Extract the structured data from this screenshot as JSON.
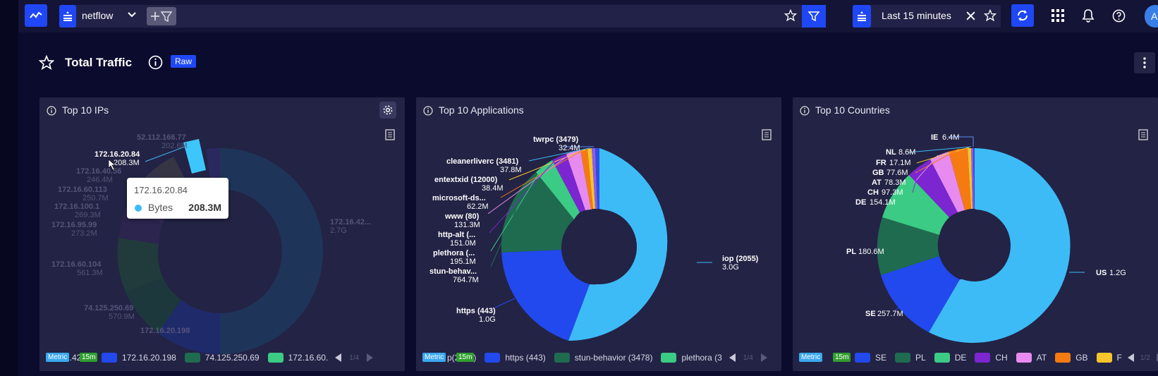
{
  "topbar": {
    "index_name": "netflow",
    "time_range": "Last 15 minutes",
    "avatar_letter": "A"
  },
  "dashboard": {
    "title": "Total Traffic",
    "badge": "Raw"
  },
  "panels": [
    {
      "title": "Top 10 IPs",
      "labels": {
        "p1": "52.112.166.77",
        "p1v": "202.6M",
        "p2": "172.16.20.84",
        "p2v": "208.3M",
        "p3": "172.16.40.56",
        "p3v": "246.4M",
        "p4": "172.16.60.113",
        "p4v": "250.7M",
        "p5": "172.16.100.1",
        "p5v": "269.3M",
        "p6": "172.16.95.99",
        "p6v": "273.2M",
        "p7": "172.16.60.104",
        "p7v": "561.3M",
        "p8": "74.125.250.69",
        "p8v": "570.9M",
        "p9": "172.16.20.198",
        "p9v": "",
        "p10": "172.16.42...",
        "p10v": "2.7G"
      },
      "tooltip": {
        "title": "172.16.20.84",
        "metric": "Bytes",
        "value": "208.3M"
      },
      "legend": [
        "7.42.31",
        "172.16.20.198",
        "74.125.250.69",
        "172.16.60."
      ],
      "pager": "1/4"
    },
    {
      "title": "Top 10 Applications",
      "labels": {
        "a1": "twrpc (3479)",
        "a1v": "32.4M",
        "a2": "cleanerliverc (3481)",
        "a2v": "37.8M",
        "a3": "entextxid (12000)",
        "a3v": "38.4M",
        "a4": "microsoft-ds...",
        "a4v": "62.2M",
        "a5": "www (80)",
        "a5v": "131.3M",
        "a6": "http-alt (...",
        "a6v": "151.0M",
        "a7": "plethora (...",
        "a7v": "195.1M",
        "a8": "stun-behav...",
        "a8v": "764.7M",
        "a9": "https (443)",
        "a9v": "1.0G",
        "a10": "iop (2055)",
        "a10v": "3.0G"
      },
      "legend": [
        "p(2055)",
        "https (443)",
        "stun-behavior (3478)",
        "plethora (3"
      ],
      "pager": "1/4"
    },
    {
      "title": "Top 10 Countries",
      "labels": {
        "c1": "IE",
        "c1v": "6.4M",
        "c2": "NL",
        "c2v": "8.6M",
        "c3": "FR",
        "c3v": "17.1M",
        "c4": "GB",
        "c4v": "77.6M",
        "c5": "AT",
        "c5v": "78.3M",
        "c6": "CH",
        "c6v": "97.3M",
        "c7": "DE",
        "c7v": "154.1M",
        "c8": "PL",
        "c8v": "180.6M",
        "c9": "SE",
        "c9v": "257.7M",
        "c10": "US",
        "c10v": "1.2G"
      },
      "legend": [
        "S",
        "SE",
        "PL",
        "DE",
        "CH",
        "AT",
        "GB",
        "F"
      ],
      "pager": "1/2"
    }
  ],
  "tags": {
    "metric": "Metric",
    "window": "15m"
  },
  "colors": {
    "accent": "#1f47f5",
    "light_blue": "#3dbbf7",
    "blue": "#2249ee",
    "dark_green": "#1f6b50",
    "green": "#3ccb84",
    "purple": "#7b26d0",
    "pink": "#e78bf0",
    "orange": "#f57a12",
    "yellow": "#f5c52b"
  }
}
